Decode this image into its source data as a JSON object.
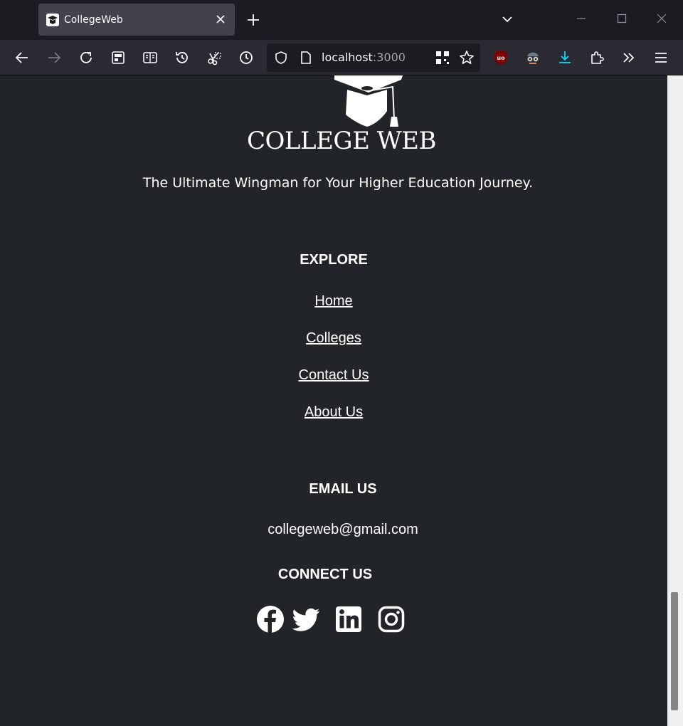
{
  "browser": {
    "tab_title": "CollegeWeb",
    "url_host": "localhost",
    "url_port": ":3000"
  },
  "site": {
    "brand": "COLLEGE WEB",
    "tagline": "The Ultimate Wingman for Your Higher Education Journey."
  },
  "explore": {
    "heading": "EXPLORE",
    "links": [
      "Home",
      "Colleges",
      "Contact Us",
      "About Us"
    ]
  },
  "email": {
    "heading": "EMAIL US",
    "address": "collegeweb@gmail.com"
  },
  "connect": {
    "heading": "CONNECT US",
    "icons": [
      "facebook-icon",
      "twitter-icon",
      "linkedin-icon",
      "instagram-icon"
    ]
  },
  "colors": {
    "page_bg": "#212529",
    "text": "#ffffff",
    "chrome_bg": "#1c1b22",
    "toolbar_bg": "#2b2a33",
    "download_accent": "#00ddff",
    "ublock_red": "#800000"
  }
}
